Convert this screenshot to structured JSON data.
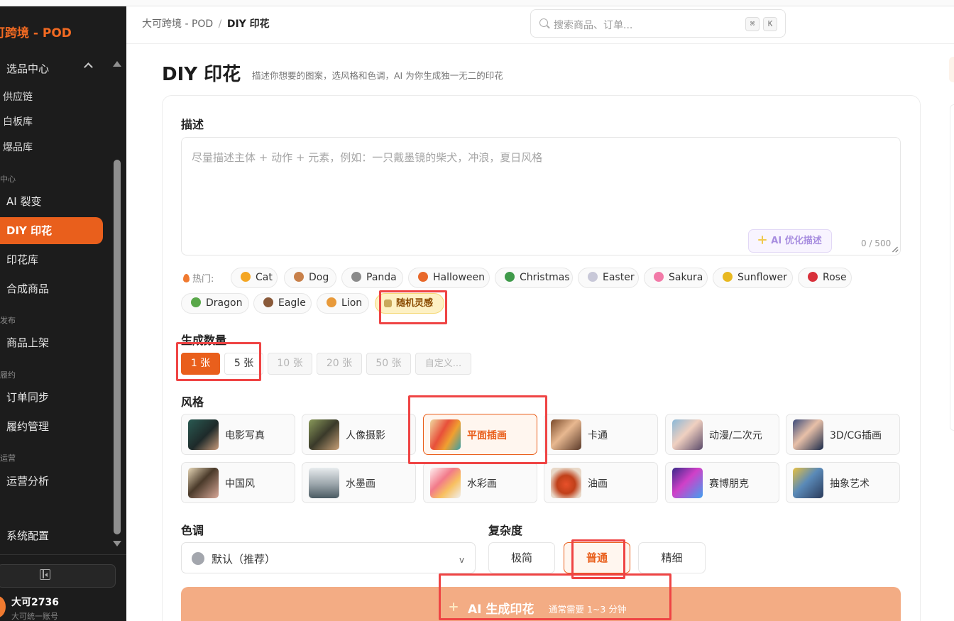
{
  "sidebar": {
    "brand": "可跨境 - POD",
    "items": [
      {
        "label": "选品中心"
      },
      {
        "label": "供应链"
      },
      {
        "label": "白板库"
      },
      {
        "label": "爆品库"
      },
      {
        "label": "AI 裂变"
      },
      {
        "label": "DIY 印花"
      },
      {
        "label": "印花库"
      },
      {
        "label": "合成商品"
      },
      {
        "label": "商品上架"
      },
      {
        "label": "订单同步"
      },
      {
        "label": "履约管理"
      },
      {
        "label": "运营分析"
      },
      {
        "label": "系统配置"
      }
    ],
    "groups": [
      "中心",
      "发布",
      "履约",
      "运营"
    ],
    "user_name": "大可2736",
    "user_sub": "大可统一账号"
  },
  "header": {
    "breadcrumb_root": "大可跨境 - POD",
    "breadcrumb_sep": "/",
    "breadcrumb_current": "DIY 印花",
    "search_placeholder": "搜索商品、订单...",
    "kbd_cmd": "⌘",
    "kbd_k": "K"
  },
  "page": {
    "title": "DIY 印花",
    "subtitle": "描述你想要的图案，选风格和色调，AI 为你生成独一无二的印花"
  },
  "description": {
    "label": "描述",
    "placeholder": "尽量描述主体 + 动作 + 元素，例如：一只戴墨镜的柴犬，冲浪，夏日风格",
    "optimize_label": "AI 优化描述",
    "char_count": "0 / 500"
  },
  "hot": {
    "label": "热门:",
    "tags": [
      {
        "label": "Cat",
        "color": "#f4a623"
      },
      {
        "label": "Dog",
        "color": "#c8804a"
      },
      {
        "label": "Panda",
        "color": "#8a8a8a"
      },
      {
        "label": "Halloween",
        "color": "#e8682a"
      },
      {
        "label": "Christmas",
        "color": "#3f9a4a"
      },
      {
        "label": "Easter",
        "color": "#c8c8d8"
      },
      {
        "label": "Sakura",
        "color": "#f27aa8"
      },
      {
        "label": "Sunflower",
        "color": "#e8b820"
      },
      {
        "label": "Rose",
        "color": "#d8303a"
      },
      {
        "label": "Dragon",
        "color": "#5aa84a"
      },
      {
        "label": "Eagle",
        "color": "#8a5a3a"
      },
      {
        "label": "Lion",
        "color": "#e89a3a"
      }
    ],
    "random_label": "随机灵感"
  },
  "quantity": {
    "label": "生成数量",
    "options": [
      "1 张",
      "5 张",
      "10 张",
      "20 张",
      "50 张",
      "自定义..."
    ]
  },
  "style": {
    "label": "风格",
    "options": [
      {
        "label": "电影写真"
      },
      {
        "label": "人像摄影"
      },
      {
        "label": "平面插画"
      },
      {
        "label": "卡通"
      },
      {
        "label": "动漫/二次元"
      },
      {
        "label": "3D/CG插画"
      },
      {
        "label": "中国风"
      },
      {
        "label": "水墨画"
      },
      {
        "label": "水彩画"
      },
      {
        "label": "油画"
      },
      {
        "label": "赛博朋克"
      },
      {
        "label": "抽象艺术"
      }
    ]
  },
  "tone": {
    "label": "色调",
    "value": "默认（推荐）",
    "chevron": "v"
  },
  "complexity": {
    "label": "复杂度",
    "options": [
      "极简",
      "普通",
      "精细"
    ]
  },
  "generate": {
    "label": "AI 生成印花",
    "sub": "通常需要 1~3 分钟"
  },
  "colors": {
    "accent": "#e95f1c",
    "sidebar_bg": "#1c1c1c",
    "generate_bg": "#f3ac84",
    "annotation": "#ef4444"
  }
}
